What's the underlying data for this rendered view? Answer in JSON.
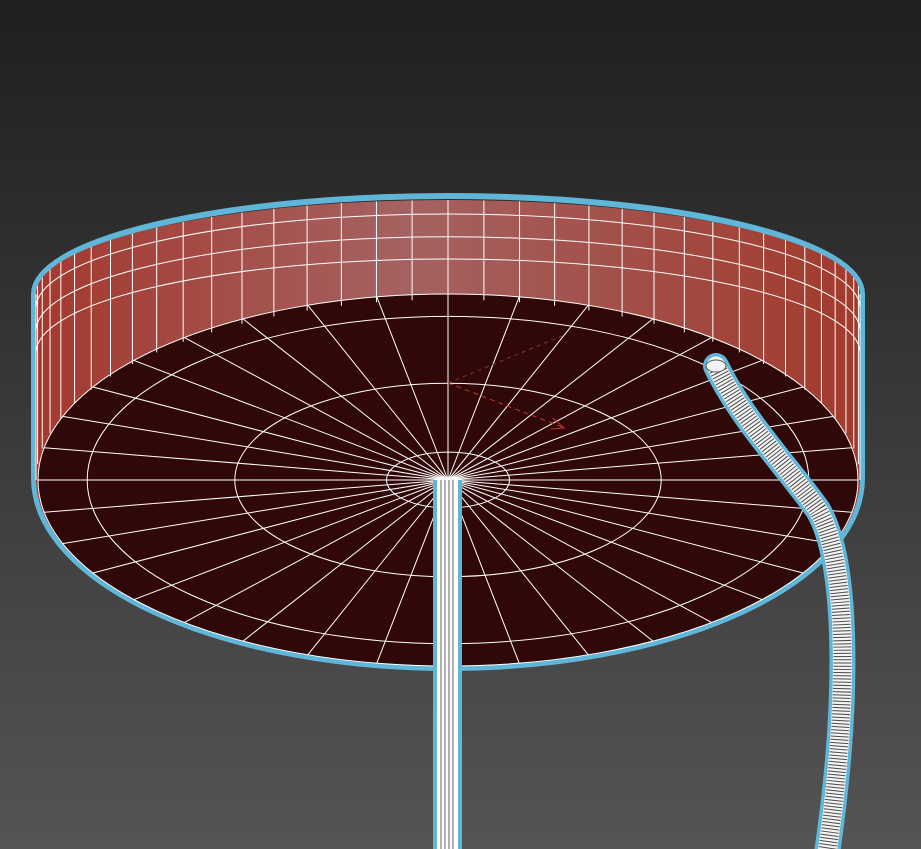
{
  "viewport": {
    "background_top": "#1f1f1f",
    "background_bottom": "#545454"
  },
  "object": {
    "selection_outline_color": "#5fb6d8",
    "wireframe_color": "#ffffff",
    "side_face_dark": "#a4392e",
    "side_face_light": "#a56262",
    "bottom_face_color": "#2f0807",
    "gizmo_color": "#c0392b"
  }
}
